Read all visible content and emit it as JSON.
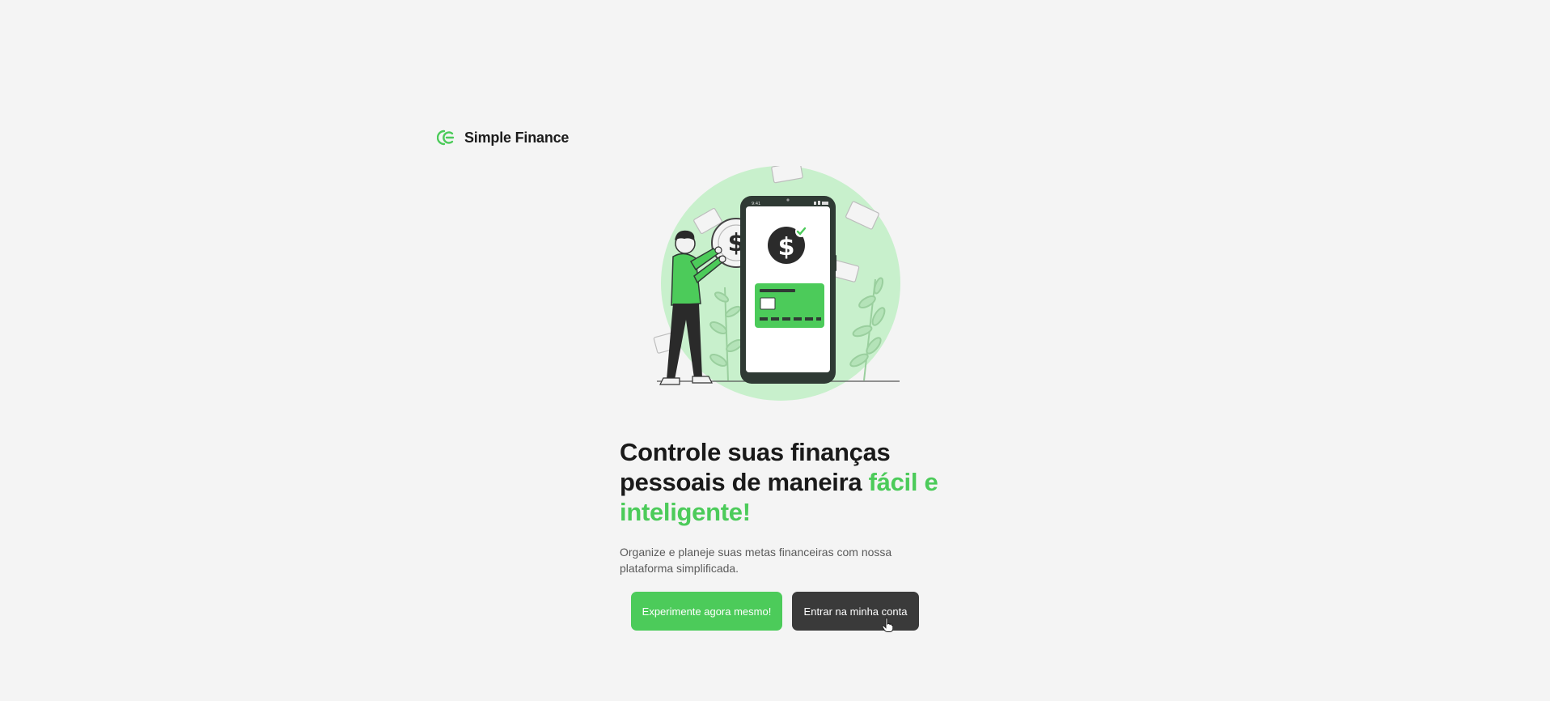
{
  "brand": {
    "name": "Simple Finance",
    "logo_icon": "simple-finance-logo-icon",
    "accent_color": "#4ccb5a"
  },
  "hero": {
    "illustration_icon": "person-with-phone-money-illustration",
    "phone_status_time": "9:41",
    "headline_part1": "Controle suas finanças pessoais de maneira ",
    "headline_accent": "fácil e inteligente!",
    "subtitle": "Organize e planeje suas metas financeiras com nossa plataforma simplificada."
  },
  "actions": {
    "primary_label": "Experimente agora mesmo!",
    "secondary_label": "Entrar na minha conta",
    "primary_color": "#4ccb5a",
    "secondary_color": "#3a3a3a",
    "cursor_icon": "hand-pointer-icon"
  }
}
